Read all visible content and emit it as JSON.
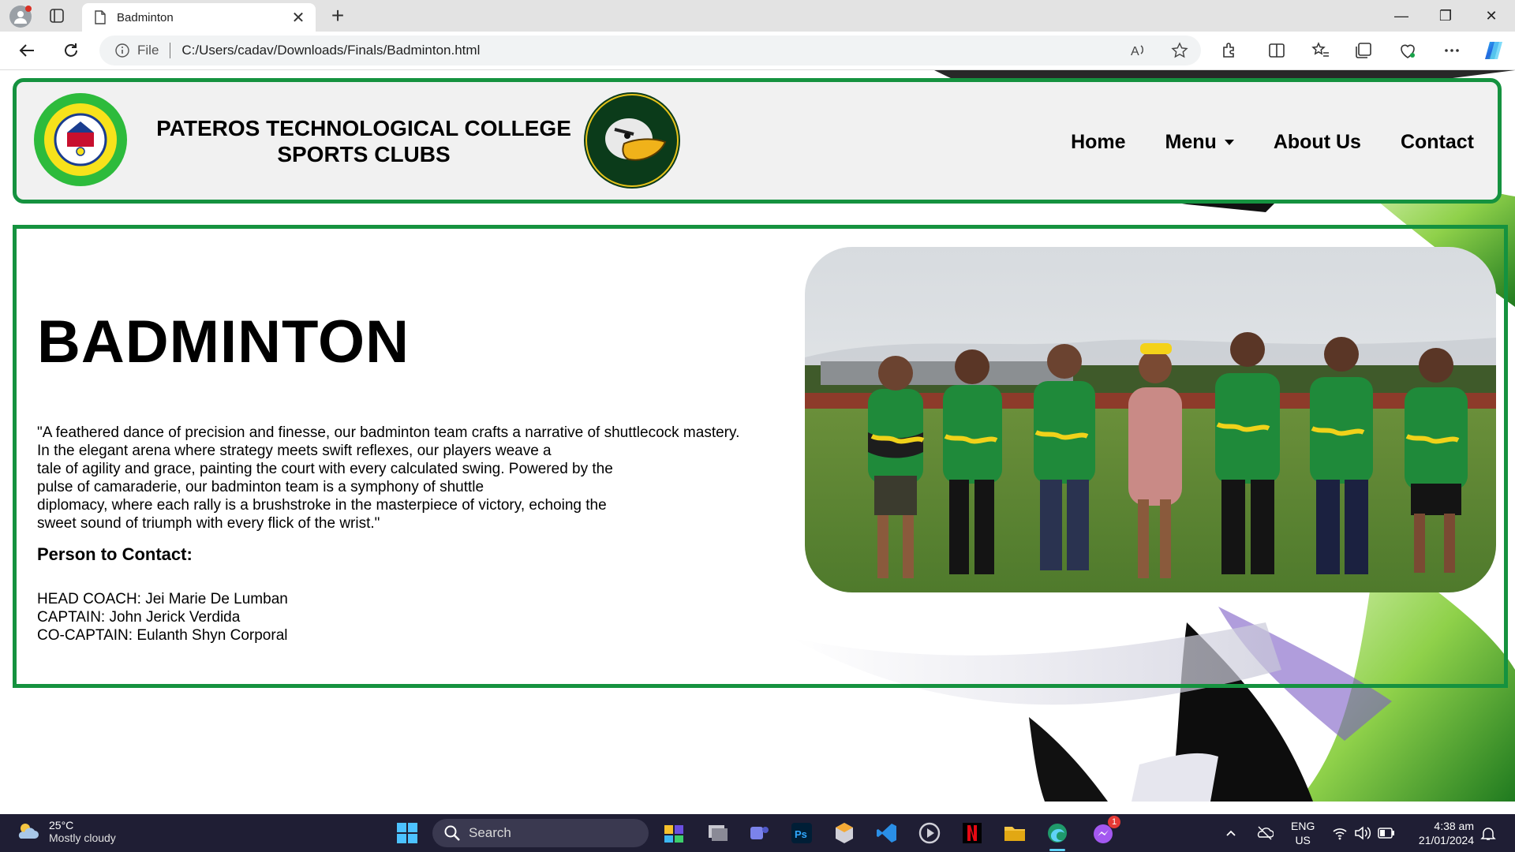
{
  "browser": {
    "tab_title": "Badminton",
    "close_symbol": "✕",
    "new_tab_symbol": "+",
    "file_label": "File",
    "url": "C:/Users/cadav/Downloads/Finals/Badminton.html",
    "window_controls": {
      "minimize": "—",
      "maximize": "❐",
      "close": "✕"
    }
  },
  "header": {
    "college_line1": "PATEROS TECHNOLOGICAL COLLEGE",
    "college_line2": "SPORTS CLUBS",
    "nav": {
      "home": "Home",
      "menu": "Menu",
      "about": "About Us",
      "contact": "Contact"
    }
  },
  "main": {
    "title": "BADMINTON",
    "quote_lines": [
      "\"A feathered dance of precision and finesse, our badminton team crafts a narrative of shuttlecock mastery.",
      "In the elegant arena where strategy meets swift reflexes, our players weave a",
      "tale of agility and grace, painting the court with every calculated swing. Powered by the",
      "pulse of camaraderie, our badminton team is a symphony of shuttle",
      "diplomacy, where each rally is a brushstroke in the masterpiece of victory, echoing the",
      "sweet sound of triumph with every flick of the wrist.\""
    ],
    "contact_heading": "Person to Contact:",
    "contacts": [
      "HEAD COACH: Jei Marie De Lumban",
      "CAPTAIN: John Jerick Verdida",
      "CO-CAPTAIN: Eulanth Shyn Corporal"
    ]
  },
  "taskbar": {
    "temperature": "25°C",
    "weather": "Mostly cloudy",
    "search_label": "Search",
    "lang_line1": "ENG",
    "lang_line2": "US",
    "time": "4:38 am",
    "date": "21/01/2024",
    "messenger_badge": "1"
  },
  "colors": {
    "accent_green": "#15923f",
    "header_bg": "#f1f1f1",
    "taskbar_bg": "#1f1e34"
  },
  "icons": [
    "profile-icon",
    "tab-actions-icon",
    "document-icon",
    "back-icon",
    "refresh-icon",
    "info-icon",
    "read-aloud-icon",
    "favorite-star-icon",
    "extensions-icon",
    "split-screen-icon",
    "favorites-icon",
    "collections-icon",
    "browser-essentials-icon",
    "more-icon",
    "copilot-icon",
    "weather-icon",
    "windows-start-icon",
    "search-icon",
    "caret-down-icon"
  ]
}
